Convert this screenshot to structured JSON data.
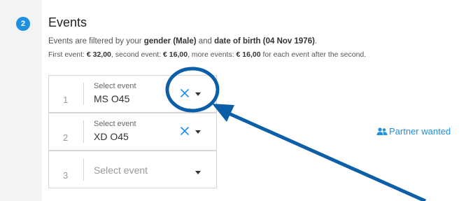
{
  "step": {
    "number": "2"
  },
  "section": {
    "title": "Events"
  },
  "description": {
    "filter_prefix": "Events are filtered by your ",
    "filter_gender": "gender (Male)",
    "filter_mid": " and ",
    "filter_dob": "date of birth (04 Nov 1976)",
    "filter_end": ".",
    "price_prefix1": "First event: ",
    "price_first": "€ 32,00",
    "price_prefix2": ", second event: ",
    "price_second": "€ 16,00",
    "price_prefix3": ", more events: ",
    "price_more": "€ 16,00",
    "price_suffix": " for each event after the second."
  },
  "events": [
    {
      "number": "1",
      "label": "Select event",
      "value": "MS O45"
    },
    {
      "number": "2",
      "label": "Select event",
      "value": "XD O45"
    },
    {
      "number": "3",
      "placeholder": "Select event"
    }
  ],
  "partner": {
    "label": "Partner wanted"
  },
  "colors": {
    "accent": "#1f8fe0",
    "annotation": "#0b5fa8"
  }
}
